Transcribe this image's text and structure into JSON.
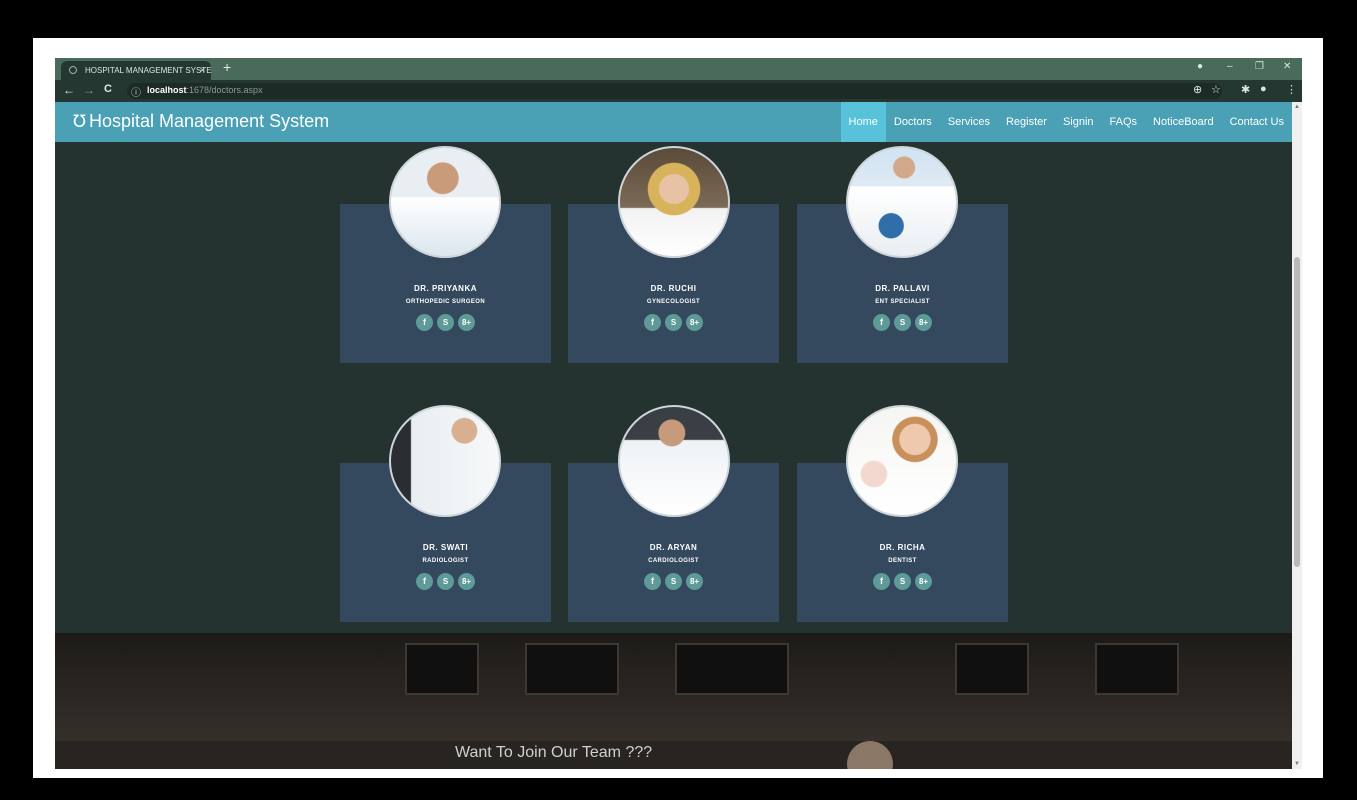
{
  "browser": {
    "tab_title": "HOSPITAL MANAGEMENT SYSTE",
    "tab_close": "×",
    "new_tab": "+",
    "url_host": "localhost",
    "url_path": ":1678/doctors.aspx",
    "icons": {
      "back": "←",
      "forward": "→",
      "reload": "C",
      "info": "ⓘ",
      "zoom": "⊕",
      "star": "☆",
      "extensions": "✱",
      "profile": "●",
      "menu": "⋮",
      "minimize": "–",
      "restore": "❐",
      "close": "✕"
    }
  },
  "site": {
    "brand": "Hospital Management System",
    "brand_icon": "stethoscope-icon",
    "menu": [
      "Home",
      "Doctors",
      "Services",
      "Register",
      "Signin",
      "FAQs",
      "NoticeBoard",
      "Contact Us"
    ],
    "active_menu": "Home"
  },
  "doctors": [
    {
      "name": "DR. PRIYANKA",
      "specialty": "ORTHOPEDIC SURGEON"
    },
    {
      "name": "DR. RUCHI",
      "specialty": "GYNECOLOGIST"
    },
    {
      "name": "DR. PALLAVI",
      "specialty": "ENT SPECIALIST"
    },
    {
      "name": "DR. SWATI",
      "specialty": "RADIOLOGIST"
    },
    {
      "name": "DR. ARYAN",
      "specialty": "CARDIOLOGIST"
    },
    {
      "name": "DR. RICHA",
      "specialty": "DENTIST"
    }
  ],
  "social": {
    "facebook": "f",
    "skype": "S",
    "google": "8+"
  },
  "footer": {
    "join_text": "Want To Join Our Team ???"
  }
}
